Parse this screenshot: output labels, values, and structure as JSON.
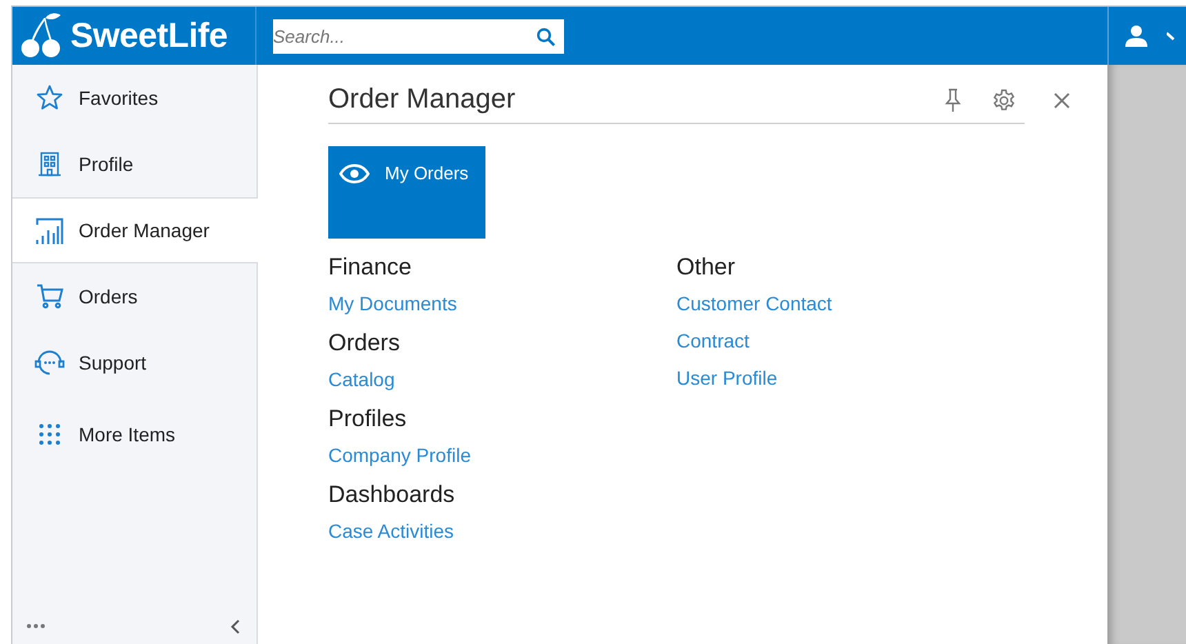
{
  "header": {
    "logo": "SweetLife",
    "search": {
      "placeholder": "Search..."
    }
  },
  "sidebar": {
    "items": [
      {
        "label": "Favorites",
        "selected": false
      },
      {
        "label": "Profile",
        "selected": false
      },
      {
        "label": "Order Manager",
        "selected": true
      },
      {
        "label": "Orders",
        "selected": false
      },
      {
        "label": "Support",
        "selected": false
      },
      {
        "label": "More Items",
        "selected": false
      }
    ]
  },
  "panel": {
    "title": "Order Manager",
    "tiles": [
      {
        "label": "My Orders"
      }
    ],
    "columns": [
      {
        "sections": [
          {
            "heading": "Finance",
            "links": [
              "My Documents"
            ]
          },
          {
            "heading": "Orders",
            "links": [
              "Catalog"
            ]
          },
          {
            "heading": "Profiles",
            "links": [
              "Company Profile"
            ]
          },
          {
            "heading": "Dashboards",
            "links": [
              "Case Activities"
            ]
          }
        ]
      },
      {
        "sections": [
          {
            "heading": "Other",
            "links": [
              "Customer Contact",
              "Contract",
              "User Profile"
            ]
          }
        ]
      }
    ]
  }
}
